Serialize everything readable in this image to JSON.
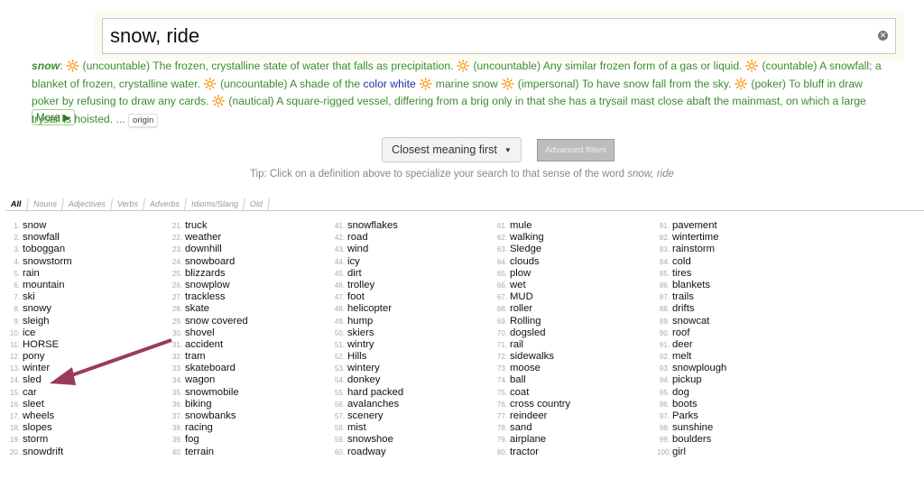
{
  "search": {
    "value": "snow, ride"
  },
  "definition": {
    "head": "snow",
    "segments": [
      {
        "t": "(uncountable) The frozen, crystalline state of water that falls as precipitation."
      },
      {
        "t": "(uncountable) Any similar frozen form of a gas or liquid."
      },
      {
        "t": "(countable) A snowfall; a blanket of frozen, crystalline water."
      },
      {
        "t": "(uncountable) A shade of the ",
        "link": "color white"
      },
      {
        "t": "marine snow"
      },
      {
        "t": "(impersonal) To have snow fall from the sky."
      },
      {
        "t": "(poker) To bluff in draw poker by refusing to draw any cards."
      },
      {
        "t": "(nautical) A square-rigged vessel, differing from a brig only in that she has a trysail mast close abaft the mainmast, on which a large trysail is hoisted. ..."
      }
    ],
    "origin_label": "origin",
    "more_label": "More ▶"
  },
  "controls": {
    "sort_label": "Closest meaning first",
    "advanced_label": "Advanced filters"
  },
  "tip": {
    "prefix": "Tip: Click on a definition above to specialize your search to that sense of the word ",
    "term": "snow, ride"
  },
  "tabs": [
    "All",
    "Nouns",
    "Adjectives",
    "Verbs",
    "Adverbs",
    "Idioms/Slang",
    "Old"
  ],
  "results": [
    "snow",
    "snowfall",
    "toboggan",
    "snowstorm",
    "rain",
    "mountain",
    "ski",
    "snowy",
    "sleigh",
    "ice",
    "HORSE",
    "pony",
    "winter",
    "sled",
    "car",
    "sleet",
    "wheels",
    "slopes",
    "storm",
    "snowdrift",
    "truck",
    "weather",
    "downhill",
    "snowboard",
    "blizzards",
    "snowplow",
    "trackless",
    "skate",
    "snow covered",
    "shovel",
    "accident",
    "tram",
    "skateboard",
    "wagon",
    "snowmobile",
    "biking",
    "snowbanks",
    "racing",
    "fog",
    "terrain",
    "snowflakes",
    "road",
    "wind",
    "icy",
    "dirt",
    "trolley",
    "foot",
    "helicopter",
    "hump",
    "skiers",
    "wintry",
    "Hills",
    "wintery",
    "donkey",
    "hard packed",
    "avalanches",
    "scenery",
    "mist",
    "snowshoe",
    "roadway",
    "mule",
    "walking",
    "Sledge",
    "clouds",
    "plow",
    "wet",
    "MUD",
    "roller",
    "Rolling",
    "dogsled",
    "rail",
    "sidewalks",
    "moose",
    "ball",
    "coat",
    "cross country",
    "reindeer",
    "sand",
    "airplane",
    "tractor",
    "pavement",
    "wintertime",
    "rainstorm",
    "cold",
    "tires",
    "blankets",
    "trails",
    "drifts",
    "snowcat",
    "roof",
    "deer",
    "melt",
    "snowplough",
    "pickup",
    "dog",
    "boots",
    "Parks",
    "sunshine",
    "boulders",
    "girl"
  ],
  "colors": {
    "definition": "#3b8c2e",
    "arrow": "#9b3a5e"
  }
}
